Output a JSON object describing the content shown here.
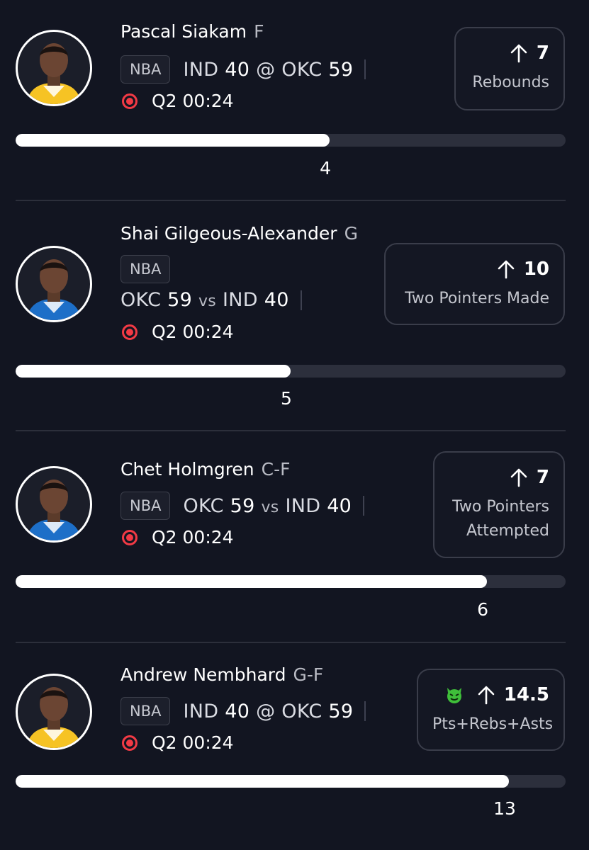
{
  "players": [
    {
      "name": "Pascal Siakam",
      "position": "F",
      "league": "NBA",
      "score_parts": [
        "IND",
        "40",
        "@",
        "OKC",
        "59"
      ],
      "game_clock": "Q2 00:24",
      "prop_line": "7",
      "prop_stat": "Rebounds",
      "prop_stat_lines": [
        "Rebounds"
      ],
      "demon": false,
      "current_value": "4",
      "progress_fraction": 0.571,
      "jersey_color": "#f6c324"
    },
    {
      "name": "Shai Gilgeous-Alexander",
      "position": "G",
      "league": "NBA",
      "score_parts": [
        "OKC",
        "59",
        "vs",
        "IND",
        "40"
      ],
      "game_clock": "Q2 00:24",
      "prop_line": "10",
      "prop_stat": "Two Pointers Made",
      "prop_stat_lines": [
        "Two Pointers Made"
      ],
      "demon": false,
      "current_value": "5",
      "progress_fraction": 0.5,
      "jersey_color": "#1d6fc8"
    },
    {
      "name": "Chet Holmgren",
      "position": "C-F",
      "league": "NBA",
      "score_parts": [
        "OKC",
        "59",
        "vs",
        "IND",
        "40"
      ],
      "game_clock": "Q2 00:24",
      "prop_line": "7",
      "prop_stat": "Two Pointers Attempted",
      "prop_stat_lines": [
        "Two Pointers",
        "Attempted"
      ],
      "demon": false,
      "current_value": "6",
      "progress_fraction": 0.857,
      "jersey_color": "#1d6fc8"
    },
    {
      "name": "Andrew Nembhard",
      "position": "G-F",
      "league": "NBA",
      "score_parts": [
        "IND",
        "40",
        "@",
        "OKC",
        "59"
      ],
      "game_clock": "Q2 00:24",
      "prop_line": "14.5",
      "prop_stat": "Pts+Rebs+Asts",
      "prop_stat_lines": [
        "Pts+Rebs+Asts"
      ],
      "demon": true,
      "current_value": "13",
      "progress_fraction": 0.897,
      "jersey_color": "#f6c324"
    }
  ],
  "icons": {
    "live": "live-indicator-icon",
    "arrow": "arrow-up-icon",
    "demon": "demon-icon"
  },
  "colors": {
    "background": "#121521",
    "live_red": "#f23a45",
    "bar_fill": "#ffffff",
    "bar_track": "#2c2f3c",
    "demon_green": "#3fbf3a"
  }
}
